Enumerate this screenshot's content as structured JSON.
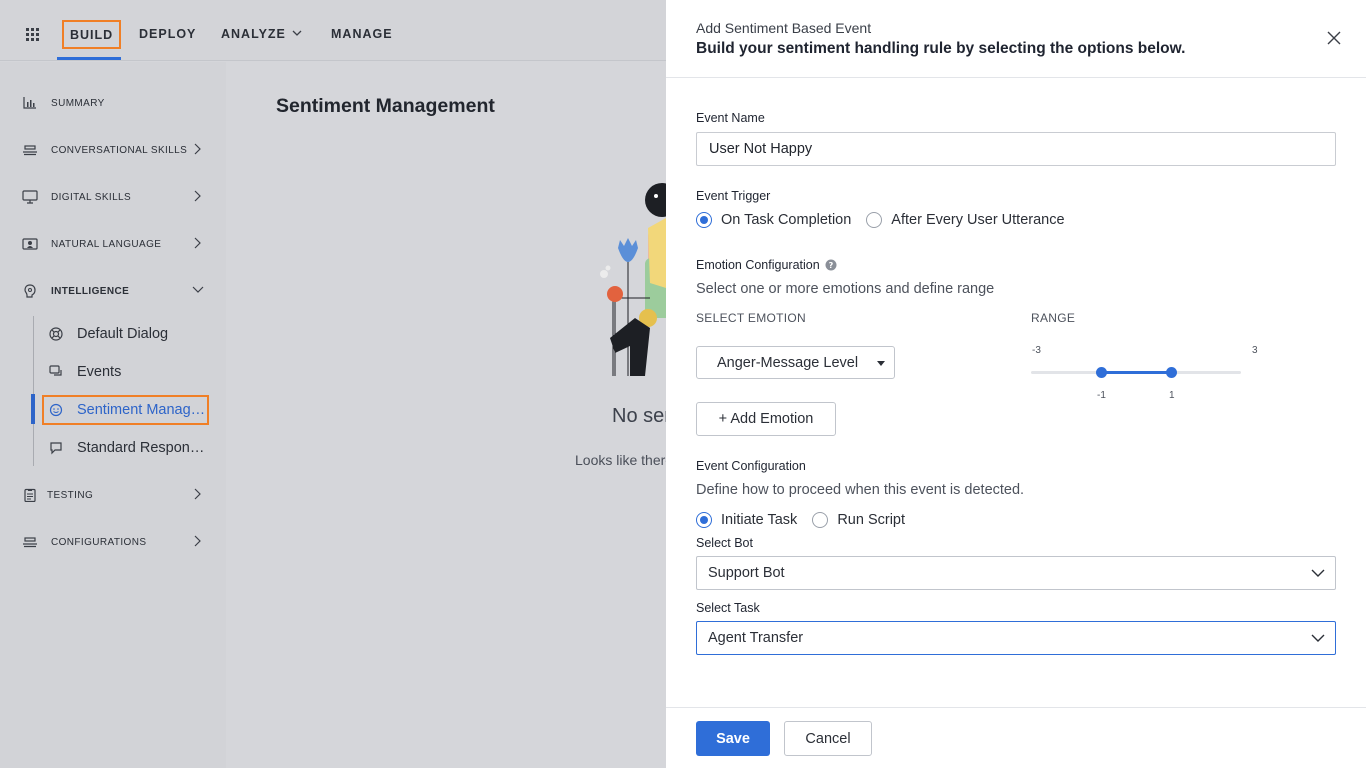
{
  "topnav": {
    "build": "BUILD",
    "deploy": "DEPLOY",
    "analyze": "ANALYZE",
    "manage": "MANAGE"
  },
  "sidebar": {
    "items": [
      {
        "label": "SUMMARY",
        "icon": "bar-chart-icon"
      },
      {
        "label": "CONVERSATIONAL SKILLS",
        "icon": "layers-icon"
      },
      {
        "label": "DIGITAL SKILLS",
        "icon": "monitor-icon"
      },
      {
        "label": "NATURAL LANGUAGE",
        "icon": "nlp-icon"
      },
      {
        "label": "INTELLIGENCE",
        "icon": "brain-icon"
      },
      {
        "label": "TESTING",
        "icon": "clipboard-icon"
      },
      {
        "label": "CONFIGURATIONS",
        "icon": "layers-icon"
      }
    ],
    "intelligence_sub": [
      {
        "label": "Default Dialog",
        "icon": "lifebuoy-icon"
      },
      {
        "label": "Events",
        "icon": "chat-bubbles-icon"
      },
      {
        "label": "Sentiment Management",
        "icon": "smiley-icon"
      },
      {
        "label": "Standard Responses",
        "icon": "message-icon"
      }
    ]
  },
  "main": {
    "title": "Sentiment Management",
    "empty_title": "No sentiment events added",
    "empty_sub": "Looks like there are no events"
  },
  "panel": {
    "kicker": "Add Sentiment Based Event",
    "heading": "Build your sentiment handling rule by selecting the options below.",
    "event_name_label": "Event Name",
    "event_name_value": "User Not Happy",
    "event_trigger_label": "Event Trigger",
    "trigger_options": [
      "On Task Completion",
      "After Every User Utterance"
    ],
    "trigger_selected": "On Task Completion",
    "emotion_config_label": "Emotion Configuration",
    "emotion_config_desc": "Select one or more emotions and define range",
    "select_emotion_caps": "SELECT EMOTION",
    "range_caps": "RANGE",
    "emotion_value": "Anger-Message Level",
    "range": {
      "min": -3,
      "max": 3,
      "low": -1,
      "high": 1,
      "min_label": "-3",
      "max_label": "3",
      "low_label": "-1",
      "high_label": "1"
    },
    "add_emotion": "+ Add Emotion",
    "event_config_label": "Event Configuration",
    "event_config_desc": "Define how to proceed when this event is detected.",
    "action_options": [
      "Initiate Task",
      "Run Script"
    ],
    "action_selected": "Initiate Task",
    "select_bot_label": "Select Bot",
    "select_bot_value": "Support Bot",
    "select_task_label": "Select Task",
    "select_task_value": "Agent Transfer",
    "save": "Save",
    "cancel": "Cancel"
  },
  "colors": {
    "accent": "#2f6ed8",
    "highlight": "#f07f26"
  }
}
